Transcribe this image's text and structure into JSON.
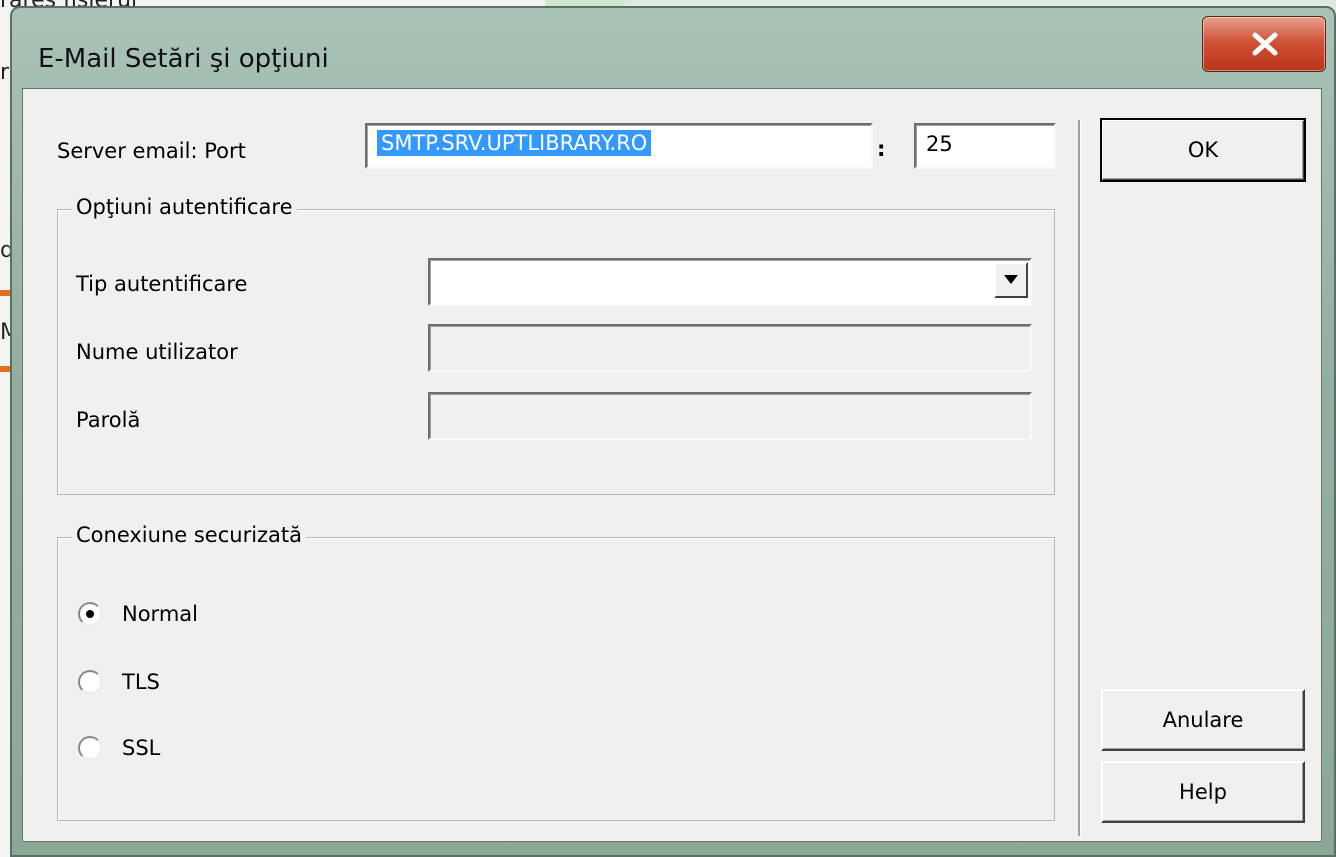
{
  "background": {
    "fragments": [
      "rares fisierul",
      "r",
      "d",
      "M"
    ]
  },
  "window": {
    "title": "E-Mail Setări şi opţiuni",
    "close_icon": "close-icon"
  },
  "server": {
    "label": "Server email: Port",
    "host_value": "SMTP.SRV.UPTLIBRARY.RO",
    "separator": ":",
    "port_value": "25"
  },
  "auth_group": {
    "title": "Opţiuni autentificare",
    "type_label": "Tip autentificare",
    "type_value": "",
    "user_label": "Nume utilizator",
    "user_value": "",
    "password_label": "Parolă",
    "password_value": ""
  },
  "secure_group": {
    "title": "Conexiune securizată",
    "options": [
      {
        "label": "Normal",
        "checked": true
      },
      {
        "label": "TLS",
        "checked": false
      },
      {
        "label": "SSL",
        "checked": false
      }
    ]
  },
  "buttons": {
    "ok": "OK",
    "cancel": "Anulare",
    "help": "Help"
  },
  "colors": {
    "selection": "#3399ff",
    "close_button": "#c8452a",
    "titlebar": "#9fbaac"
  }
}
